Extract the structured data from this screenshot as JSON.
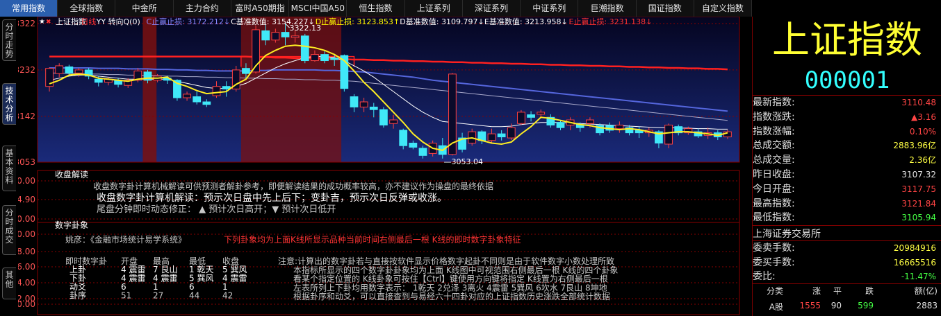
{
  "tabs": [
    "常用指数",
    "全球指数",
    "中金所",
    "主力合约",
    "富时A50期指",
    "MSCI中国A50",
    "恒生指数",
    "上证系列",
    "深证系列",
    "中证系列",
    "巨潮指数",
    "国证指数",
    "自定义指数"
  ],
  "vtabs": [
    "分时走势",
    "技术分析",
    "基本资料",
    "分时成交",
    "其他"
  ],
  "chart": {
    "header": [
      {
        "text": "上证指数",
        "color": "#ffffff"
      },
      {
        "text": "日线",
        "color": "#ff3333"
      },
      {
        "text": "YY 转向Q(0)",
        "color": "#ffffff"
      },
      {
        "text": "C止赢止损: 3172.212↓",
        "color": "#8888ff"
      },
      {
        "text": "C基准数值: 3154.227↓",
        "color": "#ffffff"
      },
      {
        "text": "D止赢止损: 3123.853↑",
        "color": "#ffff00"
      },
      {
        "text": "D基准数值: 3109.797↓",
        "color": "#ffffff"
      },
      {
        "text": "E基准数值: 3213.958↓",
        "color": "#ffffff"
      },
      {
        "text": "E止赢止损: 3231.138↓",
        "color": "#ff3333"
      }
    ],
    "y_axis": [
      "3322",
      "3232",
      "3142",
      "3053"
    ],
    "high_label": "3322.13",
    "low_label": "3053.04",
    "ymin": 3053,
    "ymax": 3322,
    "candles": [
      [
        3200,
        3235,
        3190,
        3237
      ],
      [
        3225,
        3240,
        3218,
        3245
      ],
      [
        3238,
        3226,
        3220,
        3242
      ],
      [
        3226,
        3232,
        3219,
        3236
      ],
      [
        3232,
        3220,
        3214,
        3236
      ],
      [
        3214,
        3208,
        3200,
        3220
      ],
      [
        3208,
        3214,
        3202,
        3218
      ],
      [
        3212,
        3204,
        3198,
        3216
      ],
      [
        3202,
        3212,
        3197,
        3216
      ],
      [
        3212,
        3230,
        3208,
        3236
      ],
      [
        3228,
        3212,
        3206,
        3232
      ],
      [
        3212,
        3220,
        3208,
        3224
      ],
      [
        3216,
        3212,
        3205,
        3221
      ],
      [
        3212,
        3178,
        3172,
        3214
      ],
      [
        3178,
        3185,
        3172,
        3190
      ],
      [
        3180,
        3170,
        3165,
        3190
      ],
      [
        3170,
        3165,
        3160,
        3175
      ],
      [
        3182,
        3200,
        3178,
        3210
      ],
      [
        3200,
        3195,
        3180,
        3210
      ],
      [
        3195,
        3232,
        3190,
        3240
      ],
      [
        3235,
        3225,
        3215,
        3245
      ],
      [
        3228,
        3310,
        3225,
        3318
      ],
      [
        3308,
        3290,
        3280,
        3320
      ],
      [
        3290,
        3305,
        3285,
        3312
      ],
      [
        3305,
        3296,
        3280,
        3322
      ],
      [
        3295,
        3298,
        3285,
        3310
      ],
      [
        3298,
        3250,
        3245,
        3302
      ],
      [
        3250,
        3262,
        3248,
        3270
      ],
      [
        3262,
        3250,
        3245,
        3270
      ],
      [
        3255,
        3252,
        3240,
        3262
      ],
      [
        3260,
        3196,
        3190,
        3262
      ],
      [
        3180,
        3160,
        3150,
        3185
      ],
      [
        3160,
        3170,
        3150,
        3178
      ],
      [
        3160,
        3155,
        3140,
        3168
      ],
      [
        3155,
        3125,
        3120,
        3160
      ],
      [
        3128,
        3135,
        3118,
        3145
      ],
      [
        3115,
        3085,
        3078,
        3118
      ],
      [
        3090,
        3082,
        3078,
        3095
      ],
      [
        3080,
        3066,
        3060,
        3085
      ],
      [
        3070,
        3090,
        3064,
        3095
      ],
      [
        3085,
        3068,
        3060,
        3100
      ],
      [
        3068,
        3224,
        3066,
        3226
      ],
      [
        3100,
        3078,
        3072,
        3110
      ],
      [
        3090,
        3112,
        3085,
        3118
      ],
      [
        3112,
        3095,
        3088,
        3115
      ],
      [
        3095,
        3108,
        3090,
        3118
      ],
      [
        3108,
        3102,
        3095,
        3115
      ],
      [
        3100,
        3120,
        3096,
        3128
      ],
      [
        3128,
        3150,
        3125,
        3154
      ],
      [
        3145,
        3140,
        3132,
        3152
      ],
      [
        3146,
        3150,
        3138,
        3155
      ],
      [
        3140,
        3125,
        3120,
        3146
      ],
      [
        3130,
        3120,
        3115,
        3135
      ],
      [
        3125,
        3135,
        3115,
        3140
      ],
      [
        3126,
        3120,
        3112,
        3130
      ],
      [
        3128,
        3135,
        3120,
        3140
      ],
      [
        3124,
        3110,
        3105,
        3128
      ],
      [
        3124,
        3115,
        3110,
        3130
      ],
      [
        3118,
        3125,
        3110,
        3132
      ],
      [
        3120,
        3110,
        3105,
        3125
      ],
      [
        3115,
        3110,
        3100,
        3122
      ],
      [
        3110,
        3115,
        3102,
        3120
      ],
      [
        3112,
        3090,
        3080,
        3115
      ],
      [
        3088,
        3125,
        3080,
        3128
      ],
      [
        3122,
        3110,
        3105,
        3126
      ],
      [
        3110,
        3118,
        3106,
        3122
      ],
      [
        3112,
        3104,
        3100,
        3118
      ],
      [
        3105,
        3110,
        3098,
        3120
      ],
      [
        3110,
        3102,
        3096,
        3115
      ],
      [
        3102,
        3112,
        3098,
        3116
      ]
    ],
    "ma_yellow": [
      3205,
      3212,
      3222,
      3224,
      3222,
      3216,
      3214,
      3212,
      3210,
      3214,
      3216,
      3216,
      3218,
      3206,
      3200,
      3192,
      3186,
      3188,
      3190,
      3204,
      3214,
      3240,
      3260,
      3270,
      3278,
      3280,
      3278,
      3275,
      3270,
      3262,
      3250,
      3230,
      3208,
      3190,
      3170,
      3150,
      3130,
      3108,
      3092,
      3080,
      3076,
      3090,
      3098,
      3100,
      3095,
      3090,
      3088,
      3092,
      3108,
      3122,
      3140,
      3138,
      3134,
      3130,
      3126,
      3124,
      3120,
      3118,
      3116,
      3118,
      3116,
      3112,
      3108,
      3110,
      3112,
      3112,
      3110,
      3108,
      3105,
      3110
    ],
    "ma_white": [
      3212,
      3216,
      3220,
      3222,
      3222,
      3220,
      3218,
      3216,
      3214,
      3214,
      3214,
      3214,
      3214,
      3210,
      3206,
      3202,
      3198,
      3196,
      3196,
      3200,
      3206,
      3216,
      3226,
      3236,
      3244,
      3250,
      3256,
      3258,
      3258,
      3256,
      3250,
      3240,
      3230,
      3218,
      3204,
      3190,
      3176,
      3162,
      3150,
      3140,
      3132,
      3130,
      3128,
      3126,
      3124,
      3122,
      3122,
      3123,
      3126,
      3128,
      3130,
      3130,
      3130,
      3129,
      3128,
      3127,
      3126,
      3125,
      3124,
      3123,
      3122,
      3121,
      3120,
      3120,
      3119,
      3119,
      3118,
      3118,
      3117,
      3117
    ],
    "ma_red": [
      3258,
      3258,
      3258,
      3258,
      3258,
      3258,
      3258,
      3258,
      3258,
      3258,
      3258,
      3258,
      3258,
      3258,
      3258,
      3258,
      3258,
      3258,
      3258,
      3258,
      3258,
      3257,
      3257,
      3256,
      3256,
      3255,
      3255,
      3254,
      3254,
      3253,
      3253,
      3252,
      3252,
      3251,
      3251,
      3250,
      3250,
      3249,
      3249,
      3248,
      3248,
      3247,
      3247,
      3246,
      3246,
      3245,
      3245,
      3244,
      3244,
      3243,
      3243,
      3242,
      3242,
      3241,
      3241,
      3240,
      3240,
      3239,
      3239,
      3238,
      3238,
      3237,
      3237,
      3236,
      3236,
      3235,
      3235,
      3234,
      3234,
      3233
    ],
    "ma_blue": [
      3236,
      3236,
      3236,
      3236,
      3236,
      3235,
      3235,
      3235,
      3234,
      3234,
      3234,
      3233,
      3233,
      3232,
      3232,
      3231,
      3231,
      3230,
      3230,
      3230,
      3230,
      3231,
      3231,
      3232,
      3232,
      3232,
      3232,
      3232,
      3231,
      3231,
      3230,
      3229,
      3228,
      3226,
      3224,
      3222,
      3220,
      3218,
      3215,
      3212,
      3210,
      3208,
      3206,
      3204,
      3202,
      3200,
      3198,
      3196,
      3194,
      3192,
      3190,
      3188,
      3186,
      3184,
      3182,
      3180,
      3178,
      3176,
      3174,
      3172,
      3170,
      3168,
      3166,
      3164,
      3162,
      3160,
      3158,
      3156,
      3154,
      3152
    ],
    "ma_gray": [
      3226,
      3226,
      3225,
      3225,
      3224,
      3224,
      3223,
      3223,
      3222,
      3222,
      3221,
      3221,
      3220,
      3220,
      3219,
      3219,
      3218,
      3218,
      3217,
      3217,
      3216,
      3216,
      3215,
      3215,
      3214,
      3214,
      3213,
      3213,
      3212,
      3212,
      3211,
      3210,
      3208,
      3206,
      3204,
      3202,
      3200,
      3198,
      3196,
      3194,
      3192,
      3190,
      3188,
      3186,
      3184,
      3182,
      3180,
      3178,
      3176,
      3174,
      3172,
      3170,
      3168,
      3166,
      3164,
      3162,
      3160,
      3158,
      3156,
      3154,
      3152,
      3150,
      3148,
      3146,
      3144,
      3142,
      3140,
      3138,
      3136,
      3134
    ]
  },
  "panel1": {
    "title": "收盘解读",
    "y": [
      "10.00",
      "4.90",
      "0.00"
    ],
    "line1": "收盘数字卦计算机械解读可供预测者解卦参考，即便解读结果的成功概率较高，亦不建议作为操盘的最终依据",
    "line2": "收盘数字卦计算机解读：预示次日盘中先上后下；变卦吉，预示次日反弹或收涨。",
    "line3": "尾盘分钟即时动态修正：  ▲ 预计次日高开；▼ 预计次日低开"
  },
  "panel2": {
    "title": "数字卦象",
    "y": [
      "10.00",
      "8.00",
      "6.00",
      "4.00",
      "2.00",
      "0.00"
    ],
    "origin": "姚彦：《金融市场统计易学系统》",
    "note": "下列卦象均为上面K线所显示品种当前时间右侧最后一根 K线的即时数字卦象特征",
    "table_headers": [
      "即时数字卦",
      "开盘",
      "最高",
      "最低",
      "收盘"
    ],
    "table_rows": [
      [
        "上卦",
        "4 震雷",
        "7 艮山",
        "1 乾天",
        "5 巽风"
      ],
      [
        "下卦",
        "4 震雷",
        "4 震雷",
        "5 巽风",
        "4 震雷"
      ],
      [
        "动爻",
        "6",
        "1",
        "6",
        "1"
      ],
      [
        "卦序",
        "51",
        "27",
        "44",
        "42"
      ]
    ],
    "notes": [
      "注意:计算出的数字卦若与直接按软件显示价格数字起卦不同则是由于软件数字小数处理所致",
      "本指标所显示的四个数字卦卦象均为上面 K线图中可视范围右侧最后一根 K线的四个卦象",
      "看某个指定位置的 K线卦象可按住【Ctrl】键使用方向键将指定 K线置为右侧最后一根",
      "左表所列上下卦均用数字表示：  1乾天 2兑泽 3离火 4震雷 5巽风 6坎水 7艮山 8坤地",
      "根据卦序和动爻，可以直接查到与易经六十四卦对应的上证指数历史涨跌全部统计数据"
    ]
  },
  "info": {
    "name": "上证指数",
    "code": "000001",
    "rows": [
      {
        "label": "最新指数:",
        "value": "3110.48",
        "color": "#ff4444"
      },
      {
        "label": "指数涨跌:",
        "value": "▲3.16",
        "color": "#ff4444"
      },
      {
        "label": "指数涨幅:",
        "value": "0.10%",
        "color": "#ff4444"
      },
      {
        "label": "总成交额:",
        "value": "2883.96亿",
        "color": "#ffff44"
      },
      {
        "label": "总成交量:",
        "value": "2.36亿",
        "color": "#ffff44"
      },
      {
        "label": "昨日收盘:",
        "value": "3107.32",
        "color": "#e0e0e0"
      },
      {
        "label": "今日开盘:",
        "value": "3117.75",
        "color": "#ff4444"
      },
      {
        "label": "最高指数:",
        "value": "3121.84",
        "color": "#ff4444"
      },
      {
        "label": "最低指数:",
        "value": "3105.94",
        "color": "#44ff44"
      }
    ],
    "exchange": "上海证券交易所",
    "rows2": [
      {
        "label": "委卖手数:",
        "value": "20984916",
        "color": "#ffff44"
      },
      {
        "label": "委买手数:",
        "value": "16665516",
        "color": "#ffff44"
      },
      {
        "label": "委比:",
        "value": "-11.47%",
        "color": "#44ff44"
      }
    ],
    "table_headers": [
      "分类",
      "涨",
      "平",
      "跌",
      "额(亿)"
    ],
    "table_row": [
      "A股",
      "1555",
      "90",
      "599",
      "2883"
    ]
  }
}
